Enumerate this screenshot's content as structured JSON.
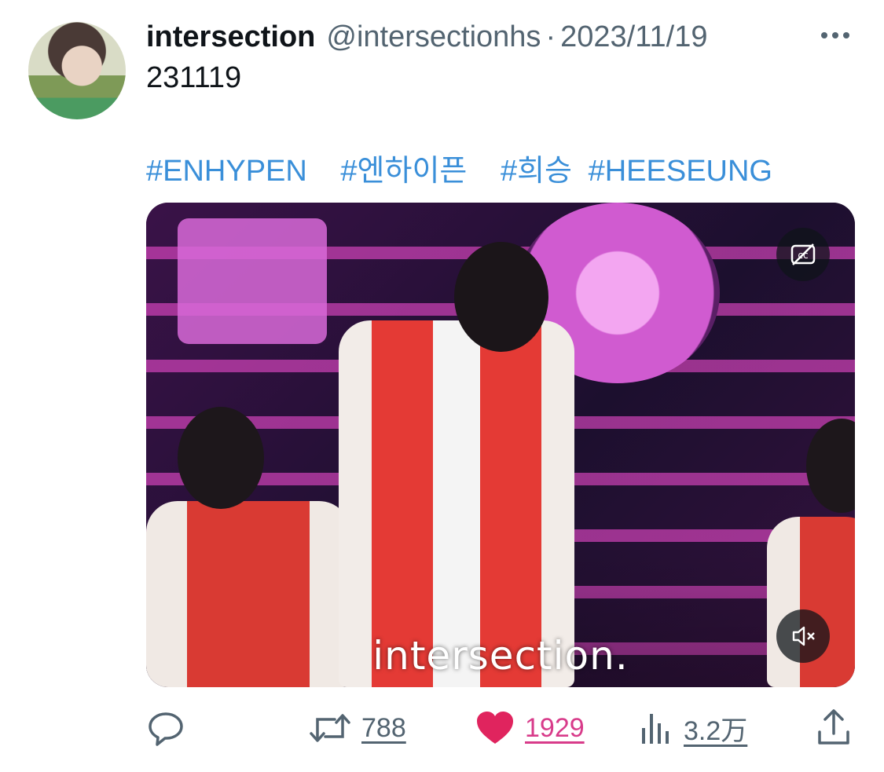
{
  "tweet": {
    "author_name": "intersection",
    "author_handle": "@intersectionhs",
    "separator": "·",
    "date": "2023/11/19",
    "text": "231119",
    "hashtags": [
      "#ENHYPEN",
      "#엔하이픈",
      "#희승",
      "#HEESEUNG"
    ],
    "media": {
      "watermark": "intersection.",
      "cc_icon": "captions-icon",
      "mute_icon": "volume-muted-icon"
    },
    "actions": {
      "reply_icon": "reply-bubble-icon",
      "retweet_count": "788",
      "like_count": "1929",
      "views_count": "3.2万",
      "share_icon": "share-icon"
    }
  },
  "colors": {
    "accent": "#3a8fd9",
    "like": "#e0245e",
    "secondary_text": "#536471"
  }
}
